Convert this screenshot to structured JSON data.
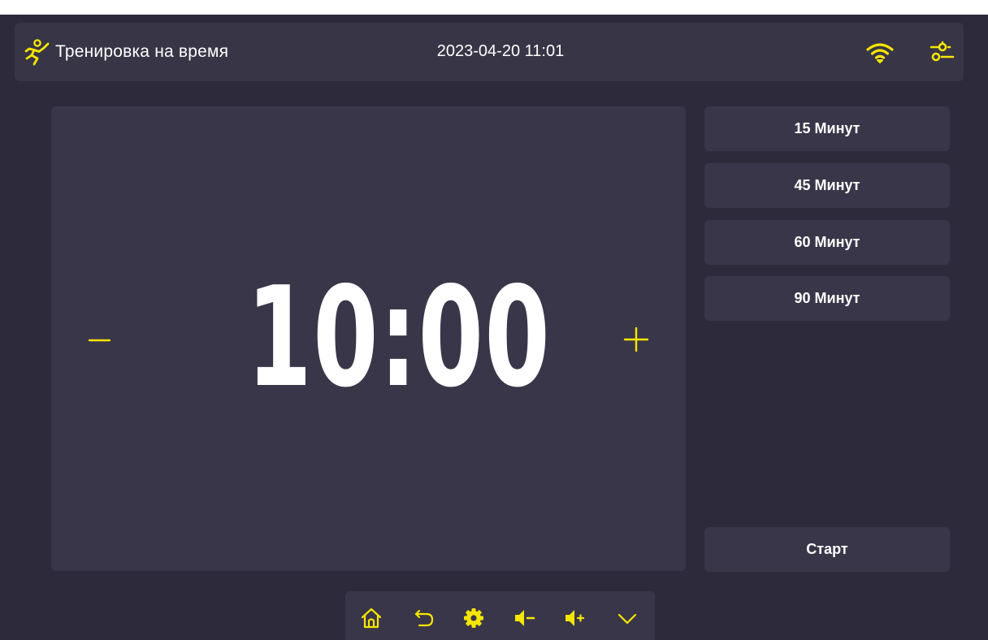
{
  "header": {
    "title": "Тренировка на время",
    "datetime": "2023-04-20 11:01",
    "icons": [
      "runner-icon",
      "wifi-icon",
      "settings-sliders-icon"
    ]
  },
  "timer": {
    "value": "10:00",
    "decrement_icon": "minus-icon",
    "increment_icon": "plus-icon"
  },
  "presets": [
    {
      "label": "15 Минут"
    },
    {
      "label": "45 Минут"
    },
    {
      "label": "60 Минут"
    },
    {
      "label": "90 Минут"
    }
  ],
  "start_label": "Старт",
  "bottom_bar": {
    "icons": [
      "home-icon",
      "back-icon",
      "gear-icon",
      "volume-down-icon",
      "volume-up-icon",
      "chevron-down-icon"
    ]
  },
  "colors": {
    "background": "#2d2b3b",
    "panel": "#3a3649",
    "header": "#383546",
    "accent": "#f5e600",
    "text": "#ffffff"
  }
}
